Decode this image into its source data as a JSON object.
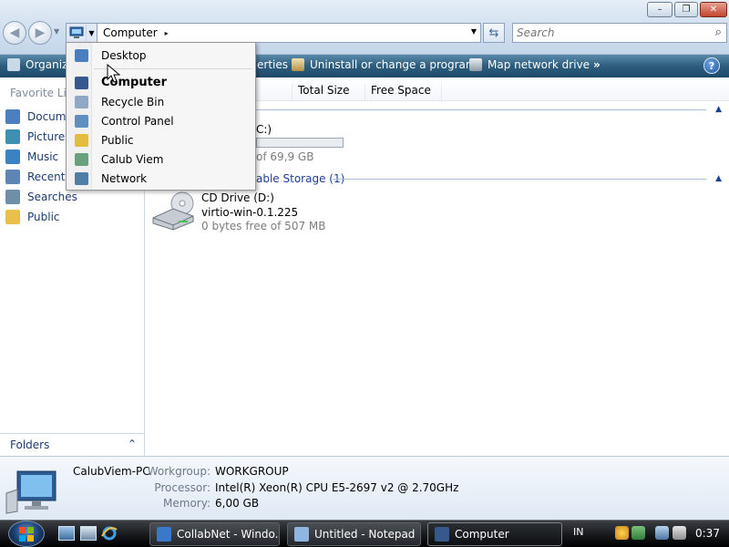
{
  "window": {
    "caption_buttons": {
      "minimize": "–",
      "maximize": "❐",
      "close": "✕"
    }
  },
  "address": {
    "text": "Computer",
    "separator": "▸",
    "search_placeholder": "Search"
  },
  "toolbar": {
    "organize": "Organize",
    "properties": "erties",
    "uninstall": "Uninstall or change a program",
    "map_drive": "Map network drive",
    "more": "»",
    "help": "?"
  },
  "favorites": {
    "header": "Favorite Lin",
    "items": [
      {
        "label": "Docume",
        "color": "#4d7fbf"
      },
      {
        "label": "Pictures",
        "color": "#3f8fb0"
      },
      {
        "label": "Music",
        "color": "#3b82c4"
      },
      {
        "label": "Recently",
        "color": "#5e86b5"
      },
      {
        "label": "Searches",
        "color": "#6f8fa8"
      },
      {
        "label": "Public",
        "color": "#e8c04a"
      }
    ],
    "folders_label": "Folders",
    "folders_chevron": "⌃"
  },
  "columns": {
    "total_size": "Total Size",
    "free_space": "Free Space"
  },
  "main": {
    "hdd_partial": "C:)",
    "hdd_free": "of 69,9 GB",
    "hdd_used_fraction": 0.0,
    "removable_group": "able Storage (1)",
    "cd_name": "CD Drive (D:)",
    "cd_label": "virtio-win-0.1.225",
    "cd_free": "0 bytes free of 507 MB"
  },
  "dropdown": {
    "items": [
      {
        "label": "Desktop",
        "bold": false,
        "color": "#4a7ec1"
      },
      {
        "label": "Computer",
        "bold": true,
        "color": "#35598c"
      },
      {
        "label": "Recycle Bin",
        "bold": false,
        "color": "#8fa9c4"
      },
      {
        "label": "Control Panel",
        "bold": false,
        "color": "#5f8fbf"
      },
      {
        "label": "Public",
        "bold": false,
        "color": "#e4bb3d"
      },
      {
        "label": "Calub Viem",
        "bold": false,
        "color": "#6aa07e"
      },
      {
        "label": "Network",
        "bold": false,
        "color": "#4f7fa8"
      }
    ]
  },
  "details": {
    "pc_name": "CalubViem-PC",
    "workgroup_label": "Workgroup:",
    "workgroup_value": "WORKGROUP",
    "processor_label": "Processor:",
    "processor_value": "Intel(R) Xeon(R) CPU E5-2697 v2 @ 2.70GHz",
    "memory_label": "Memory:",
    "memory_value": "6,00 GB"
  },
  "taskbar": {
    "tasks": [
      {
        "label": "CollabNet - Windo...",
        "active": false
      },
      {
        "label": "Untitled - Notepad",
        "active": false
      },
      {
        "label": "Computer",
        "active": true
      }
    ],
    "language": "IN",
    "clock": "0:37"
  }
}
